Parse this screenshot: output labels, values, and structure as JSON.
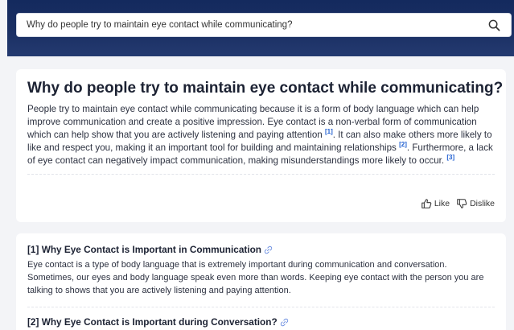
{
  "search": {
    "query": "Why do people try to maintain eye contact while communicating?"
  },
  "answer": {
    "title": "Why do people try to maintain eye contact while communicating?",
    "text_1": "People try to maintain eye contact while communicating because it is a form of body language which can help improve communication and create a positive impression. Eye contact is a non-verbal form of communication which can help show that you are actively listening and paying attention ",
    "cite_1": "[1]",
    "text_2": ". It can also make others more likely to like and respect you, making it an important tool for building and maintaining relationships ",
    "cite_2": "[2]",
    "text_3": ". Furthermore, a lack of eye contact can negatively impact communication, making misunderstandings more likely to occur. ",
    "cite_3": "[3]",
    "like_label": "Like",
    "dislike_label": "Dislike"
  },
  "sources": [
    {
      "title": "[1] Why Eye Contact is Important in Communication",
      "snippet": "Eye contact is a type of body language that is extremely important during communication and conversation. Sometimes, our eyes and body language speak even more than words. Keeping eye contact with the person you are talking to shows that you are actively listening and paying attention."
    },
    {
      "title": "[2] Why Eye Contact is Important during Conversation?"
    }
  ],
  "colors": {
    "header": "#1a2f63",
    "citation": "#1f5fd1",
    "link_icon": "#6a8de0"
  },
  "icons": {
    "search": "magnifier-icon",
    "like": "thumbs-up-icon",
    "dislike": "thumbs-down-icon",
    "source_link": "link-icon"
  }
}
